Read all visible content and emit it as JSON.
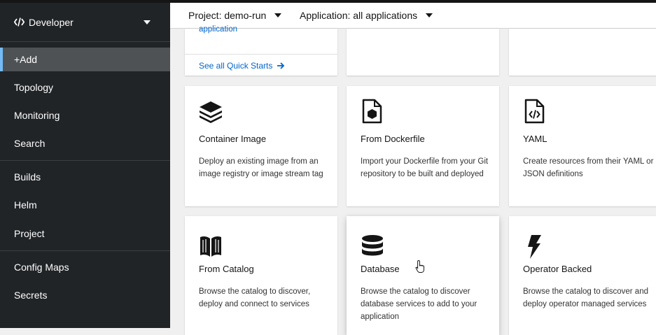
{
  "sidebar": {
    "perspective_label": "Developer",
    "groups": [
      {
        "items": [
          {
            "label": "+Add"
          },
          {
            "label": "Topology"
          },
          {
            "label": "Monitoring"
          },
          {
            "label": "Search"
          }
        ]
      },
      {
        "items": [
          {
            "label": "Builds"
          },
          {
            "label": "Helm"
          },
          {
            "label": "Project"
          }
        ]
      },
      {
        "items": [
          {
            "label": "Config Maps"
          },
          {
            "label": "Secrets"
          }
        ]
      }
    ],
    "active_item": "+Add"
  },
  "topbar": {
    "project_label": "Project: demo-run",
    "application_label": "Application: all applications"
  },
  "quick_starts": {
    "partial_text": "application",
    "see_all_label": "See all Quick Starts"
  },
  "cards": [
    {
      "title": "Container Image",
      "description": "Deploy an existing image from an image registry or image stream tag",
      "icon": "layers-icon"
    },
    {
      "title": "From Dockerfile",
      "description": "Import your Dockerfile from your Git repository to be built and deployed",
      "icon": "dockerfile-icon"
    },
    {
      "title": "YAML",
      "description": "Create resources from their YAML or JSON definitions",
      "icon": "yaml-file-icon"
    },
    {
      "title": "From Catalog",
      "description": "Browse the catalog to discover, deploy and connect to services",
      "icon": "book-icon"
    },
    {
      "title": "Database",
      "description": "Browse the catalog to discover database services to add to your application",
      "icon": "database-icon"
    },
    {
      "title": "Operator Backed",
      "description": "Browse the catalog to discover and deploy operator managed services",
      "icon": "bolt-icon"
    }
  ],
  "colors": {
    "sidebar_bg": "#212427",
    "active_bg": "#4f5255",
    "active_border": "#73bcf7",
    "link": "#0066cc"
  }
}
